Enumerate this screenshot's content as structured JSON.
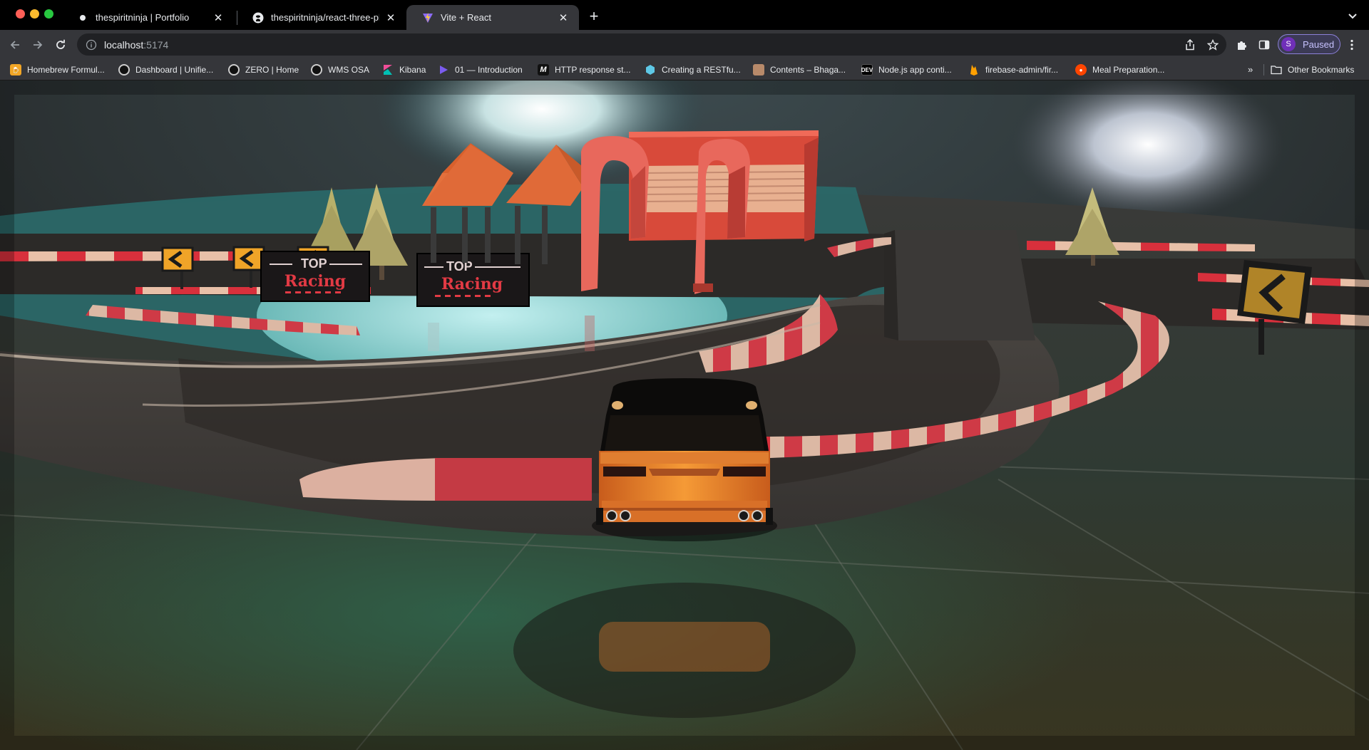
{
  "window": {
    "tabs": [
      {
        "title": "thespiritninja | Portfolio",
        "icon": "portfolio-favicon"
      },
      {
        "title": "thespiritninja/react-three-phys",
        "icon": "github-icon"
      },
      {
        "title": "Vite + React",
        "icon": "vite-icon",
        "active": true
      }
    ]
  },
  "toolbar": {
    "url_host": "localhost",
    "url_port": ":5174",
    "profile_initial": "S",
    "profile_status": "Paused"
  },
  "bookmarks": {
    "items": [
      {
        "label": "Homebrew Formul...",
        "icon": "beer-icon"
      },
      {
        "label": "Dashboard | Unifie...",
        "icon": "gitlab-icon"
      },
      {
        "label": "ZERO | Home",
        "icon": "zero-icon"
      },
      {
        "label": "WMS OSA",
        "icon": "wms-icon"
      },
      {
        "label": "Kibana",
        "icon": "kibana-icon"
      },
      {
        "label": "01 — Introduction",
        "icon": "play-icon"
      },
      {
        "label": "HTTP response st...",
        "icon": "mdn-icon"
      },
      {
        "label": "Creating a RESTfu...",
        "icon": "hexagon-icon"
      },
      {
        "label": "Contents – Bhaga...",
        "icon": "book-icon"
      },
      {
        "label": "Node.js app conti...",
        "icon": "dev-icon"
      },
      {
        "label": "firebase-admin/fir...",
        "icon": "firebase-icon"
      },
      {
        "label": "Meal Preparation...",
        "icon": "reddit-icon"
      }
    ],
    "overflow": "»",
    "other": "Other Bookmarks"
  },
  "scene": {
    "sign_top": "TOP",
    "sign_bottom": "Racing",
    "colors": {
      "curb_red": "#d8303c",
      "curb_white": "#e8c0a8",
      "arch": "#e8685c",
      "car_body": "#f0882c",
      "canopy": "#e06a38"
    }
  }
}
